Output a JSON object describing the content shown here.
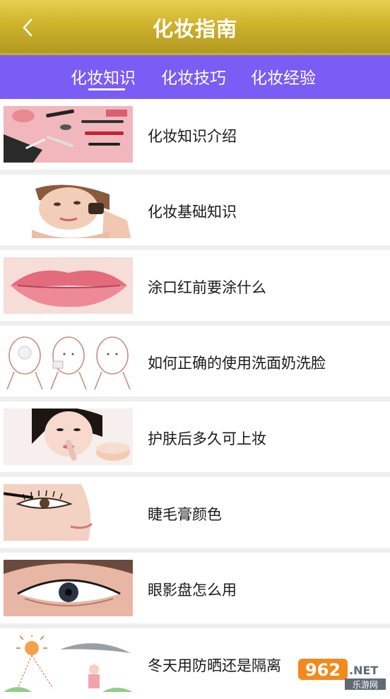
{
  "header": {
    "title": "化妆指南",
    "back_icon": "chevron-left-icon"
  },
  "tabs": [
    {
      "label": "化妆知识",
      "active": true
    },
    {
      "label": "化妆技巧",
      "active": false
    },
    {
      "label": "化妆经验",
      "active": false
    }
  ],
  "articles": [
    {
      "title": "化妆知识介绍",
      "thumbnail": "makeup-products-image"
    },
    {
      "title": "化妆基础知识",
      "thumbnail": "woman-blush-brush-image"
    },
    {
      "title": "涂口红前要涂什么",
      "thumbnail": "lips-image"
    },
    {
      "title": "如何正确的使用洗面奶洗脸",
      "thumbnail": "face-washing-steps-image"
    },
    {
      "title": "护肤后多久可上妆",
      "thumbnail": "woman-cream-image"
    },
    {
      "title": "睫毛膏颜色",
      "thumbnail": "eyelash-mascara-image"
    },
    {
      "title": "眼影盘怎么用",
      "thumbnail": "eye-shadow-image"
    },
    {
      "title": "冬天用防晒还是隔离",
      "thumbnail": "sun-umbrella-image"
    }
  ],
  "watermark": {
    "number": "962",
    "suffix": ".NET",
    "text": "乐游网"
  },
  "colors": {
    "header_gold": "#cfb32c",
    "tabbar_purple": "#7b5cf4",
    "background": "#efefef"
  }
}
